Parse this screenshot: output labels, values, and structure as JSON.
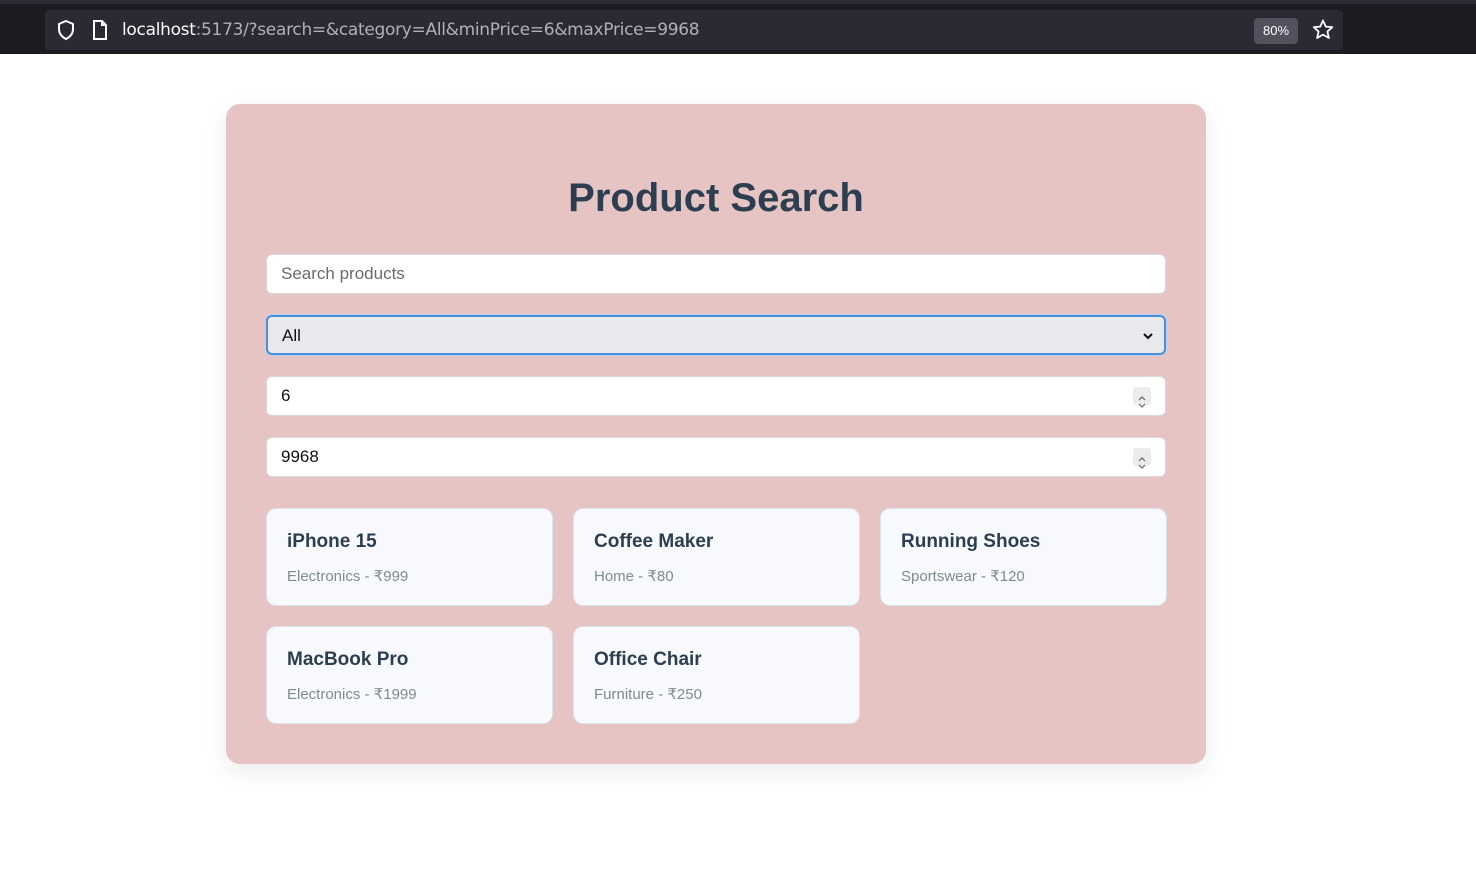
{
  "browser": {
    "url_host": "localhost",
    "url_rest": ":5173/?search=&category=All&minPrice=6&maxPrice=9968",
    "zoom": "80%"
  },
  "page": {
    "title": "Product Search",
    "search": {
      "placeholder": "Search products",
      "value": ""
    },
    "category": {
      "selected": "All"
    },
    "min_price": {
      "value": "6"
    },
    "max_price": {
      "value": "9968"
    }
  },
  "products": [
    {
      "name": "iPhone 15",
      "meta": "Electronics - ₹999"
    },
    {
      "name": "Coffee Maker",
      "meta": "Home - ₹80"
    },
    {
      "name": "Running Shoes",
      "meta": "Sportswear - ₹120"
    },
    {
      "name": "MacBook Pro",
      "meta": "Electronics - ₹1999"
    },
    {
      "name": "Office Chair",
      "meta": "Furniture - ₹250"
    }
  ]
}
